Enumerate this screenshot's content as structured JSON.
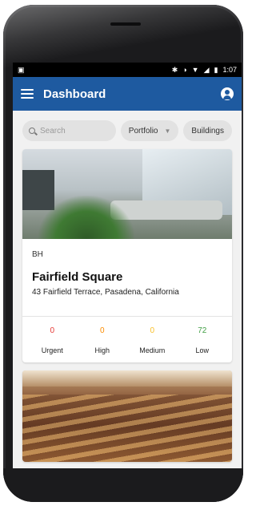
{
  "status_bar": {
    "time": "1:07"
  },
  "app_bar": {
    "title": "Dashboard"
  },
  "filters": {
    "search_placeholder": "Search",
    "chips": [
      "Portfolio",
      "Buildings"
    ]
  },
  "cards": [
    {
      "code": "BH",
      "name": "Fairfield Square",
      "address": "43 Fairfield Terrace, Pasadena, California",
      "stats": [
        {
          "label": "Urgent",
          "count": "0",
          "color": "#e53935"
        },
        {
          "label": "High",
          "count": "0",
          "color": "#fb8c00"
        },
        {
          "label": "Medium",
          "count": "0",
          "color": "#f9c02a"
        },
        {
          "label": "Low",
          "count": "72",
          "color": "#43a047"
        }
      ]
    }
  ],
  "colors": {
    "app_bar": "#1e5aa0",
    "background": "#f1f1f1"
  }
}
